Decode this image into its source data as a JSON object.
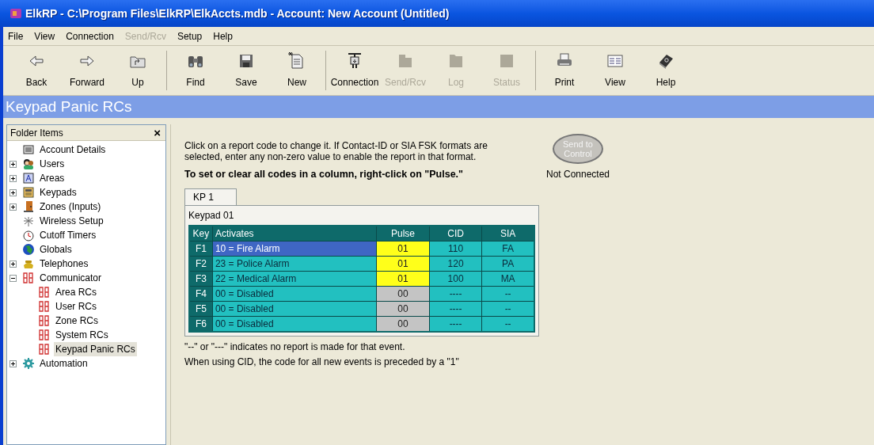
{
  "window": {
    "title": "ElkRP - C:\\Program Files\\ElkRP\\ElkAccts.mdb - Account: New Account (Untitled)"
  },
  "menu": [
    {
      "label": "File",
      "disabled": false
    },
    {
      "label": "View",
      "disabled": false
    },
    {
      "label": "Connection",
      "disabled": false
    },
    {
      "label": "Send/Rcv",
      "disabled": true
    },
    {
      "label": "Setup",
      "disabled": false
    },
    {
      "label": "Help",
      "disabled": false
    }
  ],
  "toolbar": [
    {
      "label": "Back",
      "disabled": false
    },
    {
      "label": "Forward",
      "disabled": false
    },
    {
      "label": "Up",
      "disabled": false
    },
    {
      "label": "Find",
      "disabled": false
    },
    {
      "label": "Save",
      "disabled": false
    },
    {
      "label": "New",
      "disabled": false
    },
    {
      "label": "Connection",
      "disabled": false
    },
    {
      "label": "Send/Rcv",
      "disabled": true
    },
    {
      "label": "Log",
      "disabled": true
    },
    {
      "label": "Status",
      "disabled": true
    },
    {
      "label": "Print",
      "disabled": false
    },
    {
      "label": "View",
      "disabled": false
    },
    {
      "label": "Help",
      "disabled": false
    }
  ],
  "page_title": "Keypad Panic RCs",
  "sidebar": {
    "title": "Folder Items",
    "close": "×",
    "items": [
      {
        "label": "Account Details",
        "selected": false
      },
      {
        "label": "Users",
        "selected": false,
        "expanded": false
      },
      {
        "label": "Areas",
        "selected": false,
        "expanded": false
      },
      {
        "label": "Keypads",
        "selected": false,
        "expanded": false
      },
      {
        "label": "Zones (Inputs)",
        "selected": false,
        "expanded": false
      },
      {
        "label": "Wireless Setup",
        "selected": false
      },
      {
        "label": "Cutoff Timers",
        "selected": false
      },
      {
        "label": "Globals",
        "selected": false
      },
      {
        "label": "Telephones",
        "selected": false,
        "expanded": false
      },
      {
        "label": "Communicator",
        "selected": false,
        "expanded": true,
        "children": [
          {
            "label": "Area RCs",
            "selected": false
          },
          {
            "label": "User RCs",
            "selected": false
          },
          {
            "label": "Zone RCs",
            "selected": false
          },
          {
            "label": "System RCs",
            "selected": false
          },
          {
            "label": "Keypad Panic RCs",
            "selected": true
          }
        ]
      },
      {
        "label": "Automation",
        "selected": false,
        "expanded": false
      }
    ]
  },
  "instructions": "Click on a report code to change it.  If Contact-ID or SIA FSK formats are selected, enter any non-zero value to enable the report in that format.",
  "instructions_bold": "To set or clear all codes in a column, right-click on \"Pulse.\"",
  "send_button": {
    "label": "Send to Control",
    "disabled": true
  },
  "connection_status": "Not Connected",
  "tabs": [
    {
      "label": "KP 1",
      "selected": true
    }
  ],
  "group_label": "Keypad 01",
  "table": {
    "columns": [
      "Key",
      "Activates",
      "Pulse",
      "CID",
      "SIA"
    ],
    "rows": [
      {
        "key": "F1",
        "activates": "10 = Fire Alarm",
        "pulse": "01",
        "cid": "110",
        "sia": "FA",
        "selected": true,
        "enabled": true
      },
      {
        "key": "F2",
        "activates": "23 = Police Alarm",
        "pulse": "01",
        "cid": "120",
        "sia": "PA",
        "selected": false,
        "enabled": true
      },
      {
        "key": "F3",
        "activates": "22 = Medical Alarm",
        "pulse": "01",
        "cid": "100",
        "sia": "MA",
        "selected": false,
        "enabled": true
      },
      {
        "key": "F4",
        "activates": "00 = Disabled",
        "pulse": "00",
        "cid": "----",
        "sia": "--",
        "selected": false,
        "enabled": false
      },
      {
        "key": "F5",
        "activates": "00 = Disabled",
        "pulse": "00",
        "cid": "----",
        "sia": "--",
        "selected": false,
        "enabled": false
      },
      {
        "key": "F6",
        "activates": "00 = Disabled",
        "pulse": "00",
        "cid": "----",
        "sia": "--",
        "selected": false,
        "enabled": false
      }
    ]
  },
  "notes": [
    "\"--\" or \"---\" indicates no report is made for that event.",
    "When using CID, the code for all new events is preceded by a \"1\""
  ]
}
